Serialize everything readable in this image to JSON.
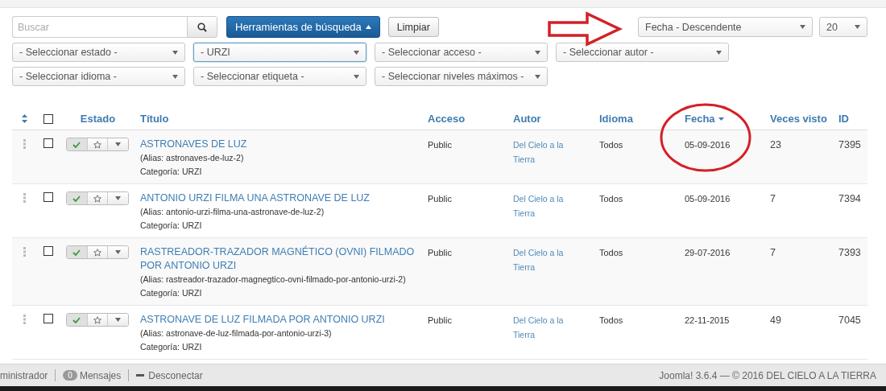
{
  "search": {
    "placeholder": "Buscar"
  },
  "search_tools_button": "Herramientas de búsqueda",
  "clear_button": "Limpiar",
  "ordering": {
    "value": "Fecha - Descendente"
  },
  "limit": {
    "value": "20"
  },
  "filters": [
    [
      {
        "value": "- Seleccionar estado -",
        "focused": false
      },
      {
        "value": "- URZI",
        "focused": true
      },
      {
        "value": "- Seleccionar acceso -",
        "focused": false
      },
      {
        "value": "- Seleccionar autor -",
        "focused": false
      }
    ],
    [
      {
        "value": "- Seleccionar idioma -",
        "focused": false
      },
      {
        "value": "- Seleccionar etiqueta -",
        "focused": false
      },
      {
        "value": "- Seleccionar niveles máximos -",
        "focused": false
      }
    ]
  ],
  "table": {
    "select_all_checked": false,
    "columns": [
      {
        "label": "Estado",
        "sorted": false
      },
      {
        "label": "Título",
        "sorted": false
      },
      {
        "label": "Acceso",
        "sorted": false
      },
      {
        "label": "Autor",
        "sorted": false
      },
      {
        "label": "Idioma",
        "sorted": false
      },
      {
        "label": "Fecha",
        "sorted": true
      },
      {
        "label": "Veces visto",
        "sorted": false
      },
      {
        "label": "ID",
        "sorted": false
      }
    ],
    "rows": [
      {
        "checked": false,
        "published": true,
        "featured": false,
        "title": "ASTRONAVES DE LUZ",
        "alias": "(Alias: astronaves-de-luz-2)",
        "category": "Categoría: URZI",
        "access": "Public",
        "author": "Del Cielo a la Tierra",
        "language": "Todos",
        "date": "05-09-2016",
        "hits": "23",
        "id": "7395"
      },
      {
        "checked": false,
        "published": true,
        "featured": false,
        "title": "ANTONIO URZI FILMA UNA ASTRONAVE DE LUZ",
        "alias": "(Alias: antonio-urzi-filma-una-astronave-de-luz-2)",
        "category": "Categoría: URZI",
        "access": "Public",
        "author": "Del Cielo a la Tierra",
        "language": "Todos",
        "date": "05-09-2016",
        "hits": "7",
        "id": "7394"
      },
      {
        "checked": false,
        "published": true,
        "featured": false,
        "title": "RASTREADOR-TRAZADOR MAGNÉTICO (OVNI) FILMADO POR ANTONIO URZI",
        "alias": "(Alias: rastreador-trazador-magnegtico-ovni-filmado-por-antonio-urzi-2)",
        "category": "Categoría: URZI",
        "access": "Public",
        "author": "Del Cielo a la Tierra",
        "language": "Todos",
        "date": "29-07-2016",
        "hits": "7",
        "id": "7393"
      },
      {
        "checked": false,
        "published": true,
        "featured": false,
        "title": "ASTRONAVE DE LUZ FILMADA POR ANTONIO URZI",
        "alias": "(Alias: astronave-de-luz-filmada-por-antonio-urzi-3)",
        "category": "Categoría: URZI",
        "access": "Public",
        "author": "Del Cielo a la Tierra",
        "language": "Todos",
        "date": "22-11-2015",
        "hits": "49",
        "id": "7045"
      }
    ]
  },
  "status_bar": {
    "user": "ministrador",
    "messages_count": "0",
    "messages_label": "Mensajes",
    "logout": "Desconectar",
    "version": "Joomla! 3.6.4 — © 2016 DEL CIELO A LA TIERRA"
  }
}
